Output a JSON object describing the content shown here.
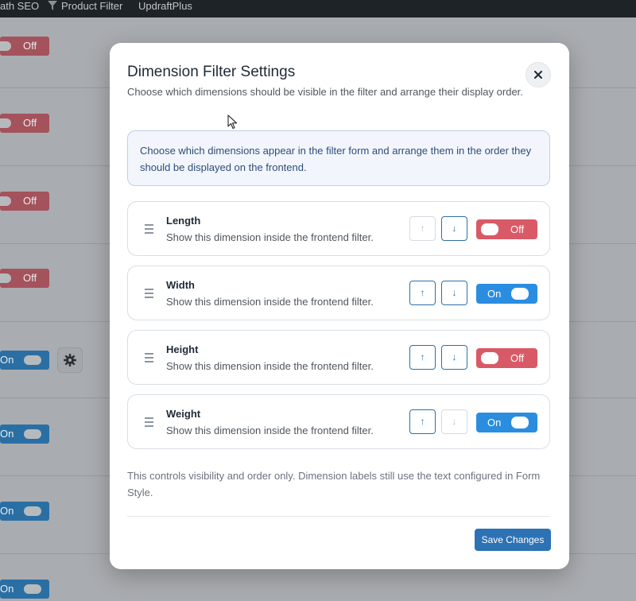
{
  "adminbar": {
    "items": [
      "ath SEO",
      "Product Filter",
      "UpdraftPlus"
    ],
    "funnel_icon": "funnel-icon"
  },
  "background": {
    "toggles": [
      {
        "state": "off",
        "label": "Off"
      },
      {
        "state": "off",
        "label": "Off"
      },
      {
        "state": "off",
        "label": "Off"
      },
      {
        "state": "off",
        "label": "Off"
      },
      {
        "state": "on",
        "label": "On"
      },
      {
        "state": "on",
        "label": "On"
      },
      {
        "state": "on",
        "label": "On"
      },
      {
        "state": "on",
        "label": "On"
      }
    ],
    "gear_icon": "gear-icon"
  },
  "modal": {
    "title": "Dimension Filter Settings",
    "subtitle": "Choose which dimensions should be visible in the filter and arrange their display order.",
    "close_icon": "close-icon",
    "notice": "Choose which dimensions appear in the filter form and arrange them in the order they should be displayed on the frontend.",
    "dimensions": [
      {
        "name": "Length",
        "description": "Show this dimension inside the frontend filter.",
        "enabled": false,
        "toggle_label": "Off",
        "can_move_up": false,
        "can_move_down": true,
        "up_glyph": "↑",
        "down_glyph": "↓"
      },
      {
        "name": "Width",
        "description": "Show this dimension inside the frontend filter.",
        "enabled": true,
        "toggle_label": "On",
        "can_move_up": true,
        "can_move_down": true,
        "up_glyph": "↑",
        "down_glyph": "↓"
      },
      {
        "name": "Height",
        "description": "Show this dimension inside the frontend filter.",
        "enabled": false,
        "toggle_label": "Off",
        "can_move_up": true,
        "can_move_down": true,
        "up_glyph": "↑",
        "down_glyph": "↓"
      },
      {
        "name": "Weight",
        "description": "Show this dimension inside the frontend filter.",
        "enabled": true,
        "toggle_label": "On",
        "can_move_up": true,
        "can_move_down": false,
        "up_glyph": "↑",
        "down_glyph": "↓"
      }
    ],
    "footer_note": "This controls visibility and order only. Dimension labels still use the text configured in Form Style.",
    "save_label": "Save Changes"
  },
  "colors": {
    "primary": "#2d72b4",
    "toggle_on": "#2a8de0",
    "toggle_off": "#d95a67"
  }
}
